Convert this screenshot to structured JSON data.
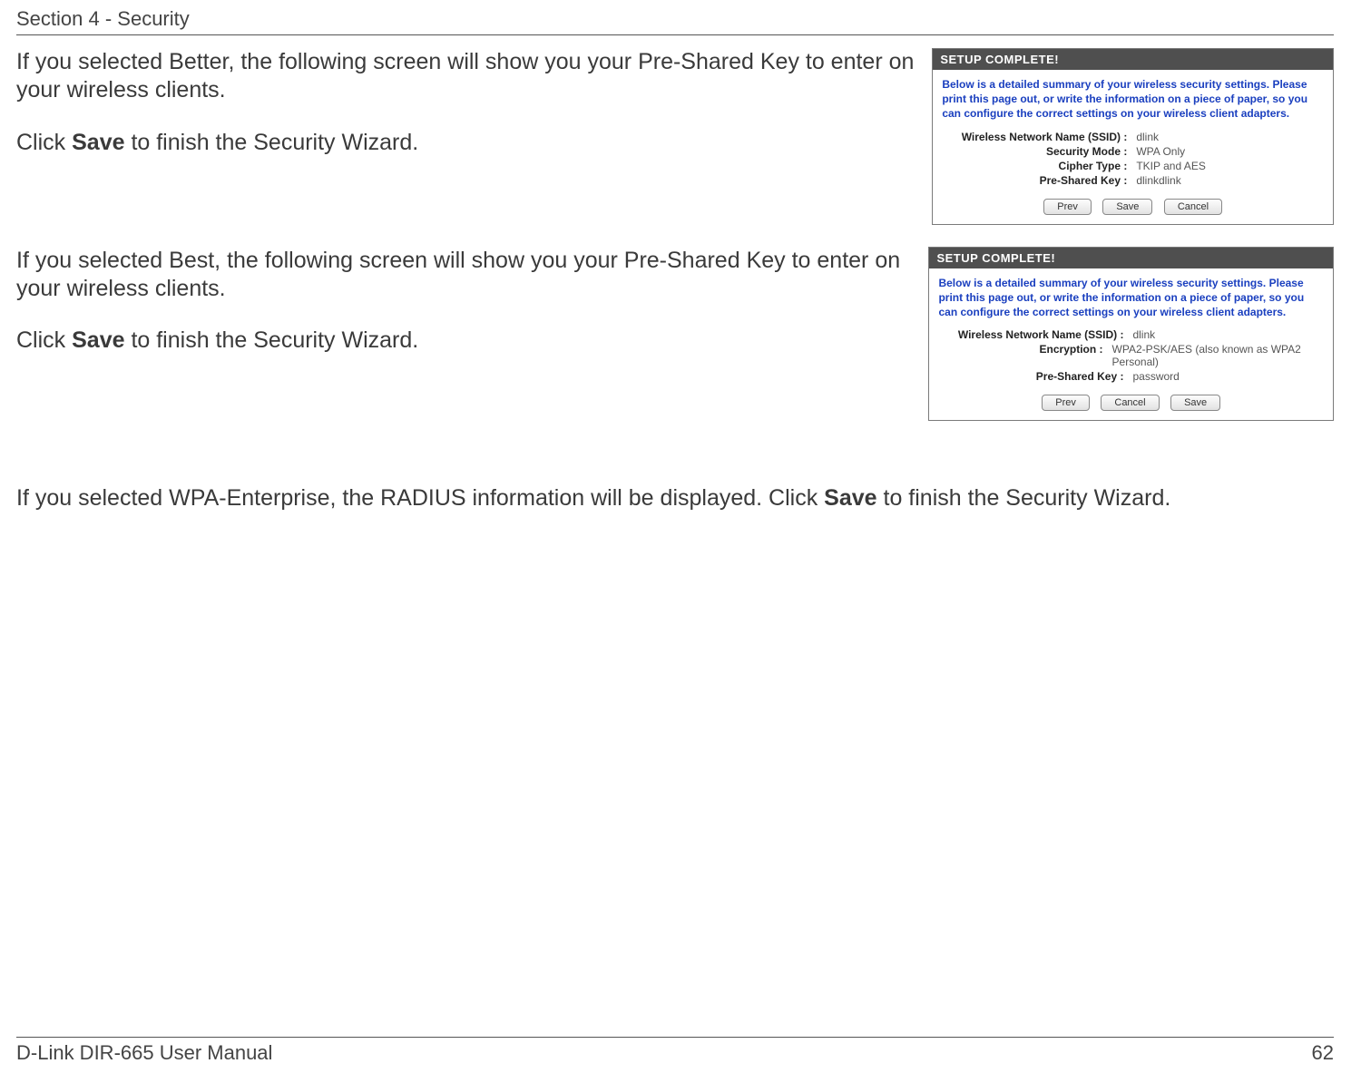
{
  "header": {
    "section": "Section 4 - Security"
  },
  "block1": {
    "p1": "If you selected Better, the following screen will show you your Pre-Shared Key to enter on your wireless clients.",
    "p2a": "Click ",
    "p2b": "Save",
    "p2c": " to finish the Security Wizard."
  },
  "panel1": {
    "title": "SETUP COMPLETE!",
    "desc": "Below is a detailed summary of your wireless security settings. Please print this page out, or write the information on a piece of paper, so you can configure the correct settings on your wireless client adapters.",
    "rows": {
      "ssid_label": "Wireless Network Name (SSID) :",
      "ssid_value": "dlink",
      "sec_label": "Security Mode :",
      "sec_value": "WPA Only",
      "cipher_label": "Cipher Type :",
      "cipher_value": "TKIP and AES",
      "psk_label": "Pre-Shared Key :",
      "psk_value": "dlinkdlink"
    },
    "buttons": {
      "prev": "Prev",
      "save": "Save",
      "cancel": "Cancel"
    }
  },
  "block2": {
    "p1": "If you selected Best, the following screen will show you your Pre-Shared Key to enter on your wireless clients.",
    "p2a": "Click ",
    "p2b": "Save",
    "p2c": " to finish the Security Wizard."
  },
  "panel2": {
    "title": "SETUP COMPLETE!",
    "desc": "Below is a detailed summary of your wireless security settings. Please print this page out, or write the information on a piece of paper, so you can configure the correct settings on your wireless client adapters.",
    "rows": {
      "ssid_label": "Wireless Network Name (SSID) :",
      "ssid_value": "dlink",
      "enc_label": "Encryption :",
      "enc_value": "WPA2-PSK/AES (also known as WPA2 Personal)",
      "psk_label": "Pre-Shared Key :",
      "psk_value": "password"
    },
    "buttons": {
      "prev": "Prev",
      "cancel": "Cancel",
      "save": "Save"
    }
  },
  "block3": {
    "a": "If you selected WPA-Enterprise, the RADIUS information will be displayed. Click ",
    "b": "Save",
    "c": " to finish the Security Wizard."
  },
  "footer": {
    "left": "D-Link DIR-665 User Manual",
    "right": "62"
  }
}
